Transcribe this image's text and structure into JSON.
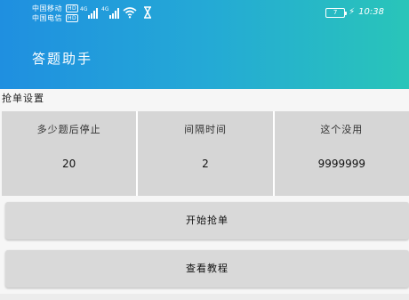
{
  "status_bar": {
    "carrier1": "中国移动",
    "carrier2": "中国电信",
    "hd_badge": "HD",
    "network_label": "4G",
    "battery_level": "7",
    "time": "10:38",
    "icons": [
      "signal-icon",
      "wifi-icon",
      "hourglass-icon",
      "battery-icon",
      "charging-icon"
    ]
  },
  "app": {
    "title": "答题助手",
    "gradient_colors": [
      "#1f8fe0",
      "#24a9d6",
      "#29c5b9"
    ]
  },
  "settings": {
    "section_title": "抢单设置",
    "items": [
      {
        "label": "多少题后停止",
        "value": "20"
      },
      {
        "label": "间隔时间",
        "value": "2"
      },
      {
        "label": "这个没用",
        "value": "9999999"
      }
    ]
  },
  "actions": {
    "start_label": "开始抢单",
    "tutorial_label": "查看教程"
  }
}
